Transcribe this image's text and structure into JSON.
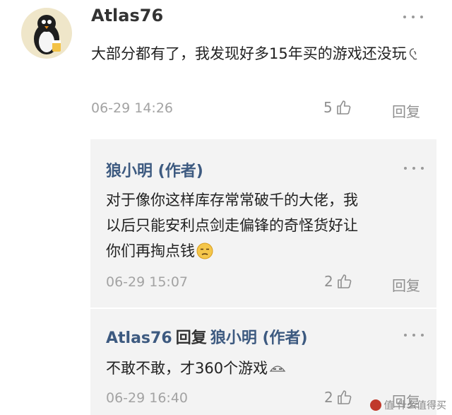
{
  "comment": {
    "username": "Atlas76",
    "text": "大部分都有了，我发现好多15年买的游戏还没玩",
    "time": "06-29 14:26",
    "likes": "5",
    "reply_label": "回复"
  },
  "replies": [
    {
      "username": "狼小明 (作者)",
      "text_line1": "对于像你这样库存常常破千的大佬，我",
      "text_line2": "以后只能安利点剑走偏锋的奇怪货好让",
      "text_line3": "你们再掏点钱",
      "time": "06-29 15:07",
      "likes": "2",
      "reply_label": "回复"
    },
    {
      "username": "Atlas76",
      "reply_word": "回复",
      "target": "狼小明 (作者)",
      "text": "不敢不敢，才360个游戏",
      "time": "06-29 16:40",
      "likes": "2",
      "reply_label": "回复"
    }
  ],
  "watermark": {
    "text": "值 什么值得买"
  }
}
